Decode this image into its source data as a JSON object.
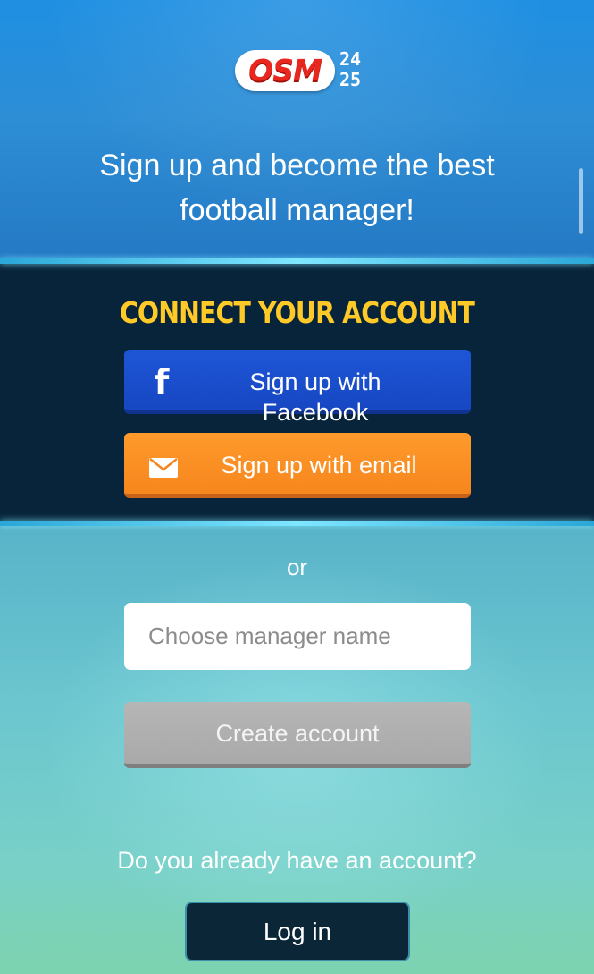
{
  "header": {
    "logo_text": "OSM",
    "logo_year_top": "24",
    "logo_year_bottom": "25",
    "tagline": "Sign up and become the best football manager!"
  },
  "connect": {
    "title": "CONNECT YOUR ACCOUNT",
    "facebook_label": "Sign up with Facebook",
    "email_label": "Sign up with email"
  },
  "signup": {
    "or_label": "or",
    "name_placeholder": "Choose manager name",
    "name_value": "",
    "create_label": "Create account"
  },
  "login": {
    "prompt": "Do you already have an account?",
    "button_label": "Log in"
  },
  "icons": {
    "facebook": "facebook-icon",
    "email": "envelope-icon"
  },
  "colors": {
    "header_blue": "#2d8ed6",
    "band_dark": "#08243a",
    "title_yellow": "#ffc928",
    "facebook_blue": "#1747c3",
    "email_orange": "#f6861d",
    "create_gray": "#a9a9a9",
    "login_dark": "#0b2637",
    "logo_red": "#e8271f"
  }
}
